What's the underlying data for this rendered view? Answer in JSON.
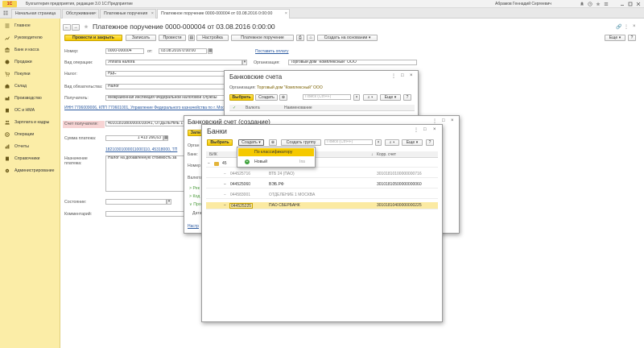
{
  "app": {
    "logo": "1С",
    "title": "Бухгалтерия предприятия, редакция 3.0  1С:Предприятие",
    "user": "Абрамов Геннадий Сергеевич"
  },
  "tabs": [
    {
      "label": "Начальная страница"
    },
    {
      "label": "Обслуживание"
    },
    {
      "label": "Платежные поручения"
    },
    {
      "label": "Платежное поручение 0000-000004 от 03.08.2016 0:00:00"
    }
  ],
  "sidebar": {
    "items": [
      {
        "label": "Главное"
      },
      {
        "label": "Руководителю"
      },
      {
        "label": "Банк и касса"
      },
      {
        "label": "Продажи"
      },
      {
        "label": "Покупки"
      },
      {
        "label": "Склад"
      },
      {
        "label": "Производство"
      },
      {
        "label": "ОС и НМА"
      },
      {
        "label": "Зарплата и кадры"
      },
      {
        "label": "Операции"
      },
      {
        "label": "Отчеты"
      },
      {
        "label": "Справочники"
      },
      {
        "label": "Администрирование"
      }
    ]
  },
  "doc": {
    "title": "Платежное поручение 0000-000004 от 03.08.2016 0:00:00",
    "toolbar": {
      "post_close": "Провести и закрыть",
      "save": "Записать",
      "post": "Провести",
      "settings": "Настройка",
      "print_order": "Платежное поручение",
      "create_based": "Создать на основании",
      "more": "Еще",
      "help": "?"
    },
    "number_label": "Номер:",
    "number_value": "0000-000004",
    "date_label": "от:",
    "date_value": "03.08.2016  0:00:00",
    "print_link": "Поставить оплату",
    "optype_label": "Вид операции:",
    "optype_value": "Уплата налога",
    "org_label": "Организация:",
    "org_value": "Торговый дом \"Комплексный\" ООО",
    "tax_label": "Налог:",
    "tax_value": "НДС",
    "obligation_label": "Вид обязательства:",
    "obligation_value": "Налог",
    "recipient_label": "Получатель:",
    "recipient_value": "Межрайонная инспекция Федеральной налоговой службы",
    "inn_link": "ИНН 7706009006, КПП 770601001, Управление Федерального казначейства по г. Москве",
    "account_label": "Счет получателя:",
    "account_value": "40101810800000010041, ОТДЕЛЕНИЕ 1 МОСКВА",
    "sum_label": "Сумма платежа:",
    "sum_value": "1 413 266,63",
    "codes_link": "18210301000011000110, 45318000, ТП",
    "purpose_label": "Назначение платежа:",
    "purpose_value": "Налог на добавленную стоимость за",
    "state_label": "Состояние:",
    "comment_label": "Комментарий:"
  },
  "accounts_window": {
    "title": "Банковские счета",
    "org_label": "Организация:",
    "org_value": "Торговый дом \"Комплексный\" ООО",
    "select": "Выбрать",
    "create": "Создать",
    "search_placeholder": "Поиск (Ctrl+F)",
    "more": "Еще",
    "help": "?",
    "col_currency": "Валюта",
    "col_name": "Наименование"
  },
  "account_create_window": {
    "title": "Банковский счет (создание)",
    "org_label": "Орган",
    "bank_label": "Банк:",
    "number_label": "Номер",
    "currency_label": "Валюта",
    "section1": "Рек",
    "section2": "Код",
    "section3": "Про",
    "date_label": "Дата",
    "settings_link": "Настр"
  },
  "banks_window": {
    "title": "Банки",
    "select": "Выбрать",
    "create": "Создать",
    "create_group": "Создать группу",
    "search_placeholder": "Поиск (Ctrl+F)",
    "more": "Еще",
    "help": "?",
    "col_bik": "БИК",
    "col_corr": "Корр. счет",
    "group_row": "45",
    "rows": [
      {
        "bik": "044525716",
        "name": "ВТБ 24 (ПАО)",
        "corr": "30101810100000000716"
      },
      {
        "bik": "044525060",
        "name": "ВЭБ.РФ",
        "corr": "30101810500000000060"
      },
      {
        "bik": "044583001",
        "name": "ОТДЕЛЕНИЕ 1 МОСКВА",
        "corr": ""
      },
      {
        "bik": "044525225",
        "name": "ПАО СБЕРБАНК",
        "corr": "30101810400000000225"
      }
    ],
    "menu": [
      {
        "label": "По классификатору",
        "shortcut": ""
      },
      {
        "label": "Новый",
        "shortcut": "Ins"
      }
    ]
  },
  "colors": {
    "sidebar": "#fbeda7",
    "accent_yellow": "#f5c900",
    "selected_row": "#fbeaa2",
    "link": "#2c5aa0",
    "account_highlight": "#f7d4d4"
  }
}
